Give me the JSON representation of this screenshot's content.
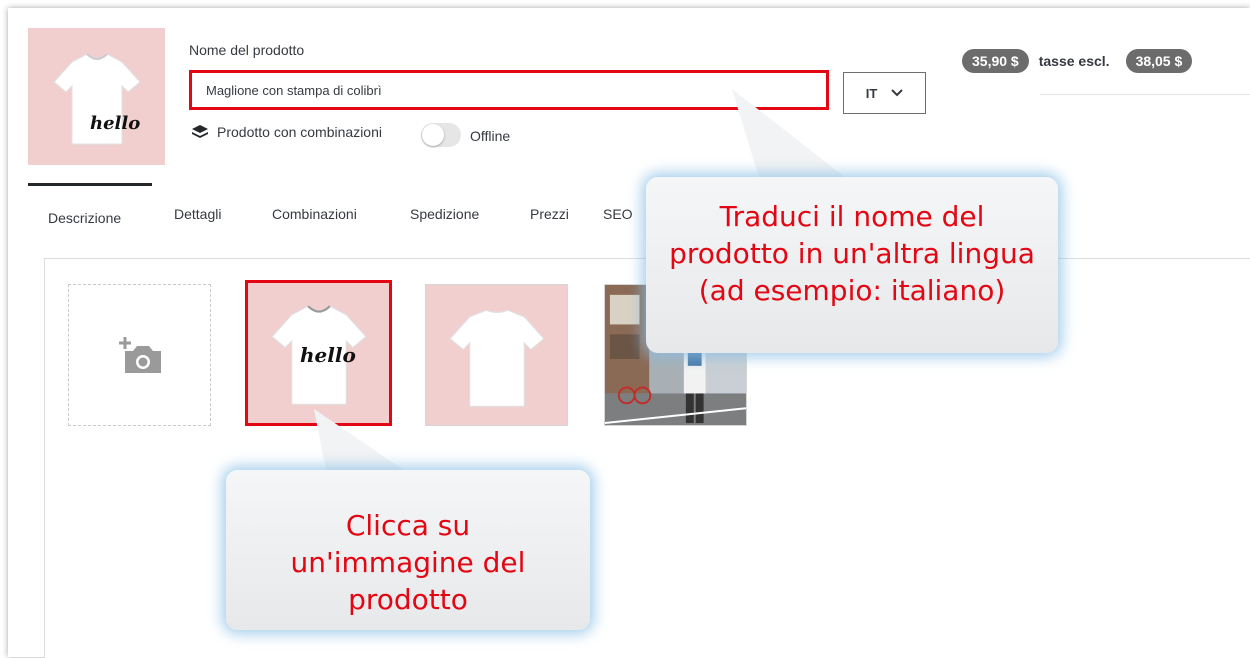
{
  "product": {
    "name_label": "Nome del prodotto",
    "name_value": "Maglione con stampa di colibrì",
    "thumbnail_text": "hello",
    "language": "IT",
    "combinations_label": "Prodotto con combinazioni",
    "online_toggle": false,
    "status_label": "Offline"
  },
  "price": {
    "tax_excl_value": "35,90 $",
    "tax_excl_label": "tasse escl.",
    "tax_incl_value": "38,05 $"
  },
  "tabs": [
    {
      "label": "Descrizione",
      "active": true
    },
    {
      "label": "Dettagli",
      "active": false
    },
    {
      "label": "Combinazioni",
      "active": false
    },
    {
      "label": "Spedizione",
      "active": false
    },
    {
      "label": "Prezzi",
      "active": false
    },
    {
      "label": "SEO",
      "active": false
    }
  ],
  "images": {
    "add_icon": "add-photo-icon",
    "tiles": [
      {
        "content": "hello",
        "selected": true
      },
      {
        "content": "",
        "selected": false
      },
      {
        "content": "",
        "selected": false
      }
    ]
  },
  "tooltips": {
    "translate": "Traduci il nome del prodotto in un'altra lingua (ad esempio: italiano)",
    "click_image": "Clicca su un'immagine del prodotto"
  },
  "colors": {
    "highlight": "#e30613",
    "price_pill": "#6c6c6c",
    "image_bg": "#f1cfcf",
    "tooltip_glow": "#87bee6"
  }
}
